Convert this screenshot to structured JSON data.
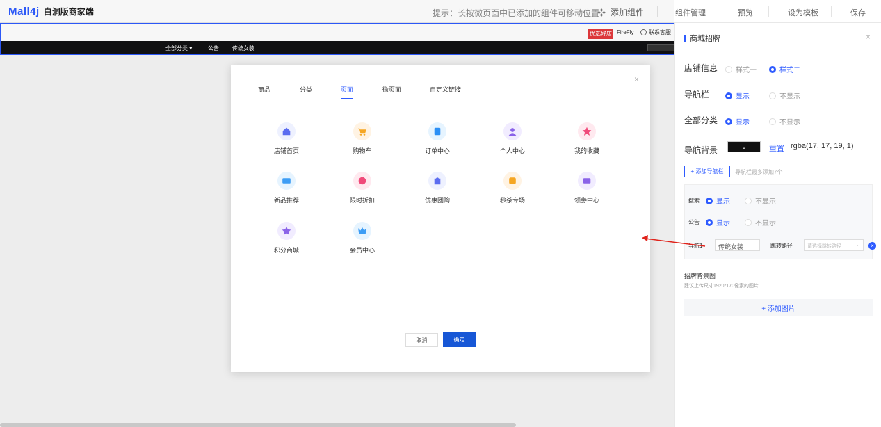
{
  "header": {
    "logo_brand": "Mall4j",
    "logo_sub": "白洞版商家端",
    "hint": "提示：长按微页面中已添加的组件可移动位置",
    "add_component": "添加组件",
    "component_manage": "组件管理",
    "preview": "预览",
    "set_template": "设为模板",
    "save": "保存"
  },
  "shop": {
    "badge": "优选好店",
    "name": "FireFly",
    "service": "联系客服",
    "nav_all": "全部分类 ▾",
    "nav_notice": "公告",
    "nav_item": "传统女装"
  },
  "panel": {
    "title": "商城招牌",
    "close": "×",
    "store_info_label": "店铺信息",
    "style_one": "样式一",
    "style_two": "样式二",
    "navbar_label": "导航栏",
    "show": "显示",
    "hide": "不显示",
    "all_category_label": "全部分类",
    "nav_bg_label": "导航背景",
    "reset": "重置",
    "rgba": "rgba(17, 17, 19, 1)",
    "nav_bg_color": "#111113",
    "add_nav_button": "+ 添加导航栏",
    "add_nav_tip": "导航栏最多添加7个",
    "search_label": "搜索",
    "notice_label": "公告",
    "nav1_label": "导航1",
    "nav1_value": "传统女装",
    "jump_label": "跳转路径",
    "jump_placeholder": "请选择跳转路径",
    "bg_image_title": "招牌背景图",
    "bg_image_tip": "建议上传尺寸1920*170像素的图片",
    "add_image": "+ 添加图片"
  },
  "modal": {
    "close": "×",
    "tabs": [
      "商品",
      "分类",
      "页面",
      "微页面",
      "自定义链接"
    ],
    "active_tab": "页面",
    "items": [
      {
        "label": "店铺首页",
        "icon": "home-icon",
        "color": "#eef1ff",
        "fg": "#5b6cf0"
      },
      {
        "label": "购物车",
        "icon": "cart-icon",
        "color": "#fff3e3",
        "fg": "#f5a623"
      },
      {
        "label": "订单中心",
        "icon": "order-icon",
        "color": "#e6f4ff",
        "fg": "#2b8ff5"
      },
      {
        "label": "个人中心",
        "icon": "user-icon",
        "color": "#f1ecff",
        "fg": "#8a63e8"
      },
      {
        "label": "我的收藏",
        "icon": "star-icon",
        "color": "#ffe9ef",
        "fg": "#f04a7a"
      },
      {
        "label": "新品推荐",
        "icon": "new-icon",
        "color": "#e6f4ff",
        "fg": "#3d9df5"
      },
      {
        "label": "限时折扣",
        "icon": "discount-icon",
        "color": "#ffe9ef",
        "fg": "#f04a7a"
      },
      {
        "label": "优惠团购",
        "icon": "group-buy-icon",
        "color": "#eef1ff",
        "fg": "#5b6cf0"
      },
      {
        "label": "秒杀专场",
        "icon": "flash-sale-icon",
        "color": "#fff3e3",
        "fg": "#f5a623"
      },
      {
        "label": "领劵中心",
        "icon": "coupon-icon",
        "color": "#f1ecff",
        "fg": "#8a63e8"
      },
      {
        "label": "积分商城",
        "icon": "points-icon",
        "color": "#f1ecff",
        "fg": "#8a63e8"
      },
      {
        "label": "会员中心",
        "icon": "vip-icon",
        "color": "#e6f4ff",
        "fg": "#3d9df5"
      }
    ],
    "cancel": "取消",
    "confirm": "确定"
  }
}
